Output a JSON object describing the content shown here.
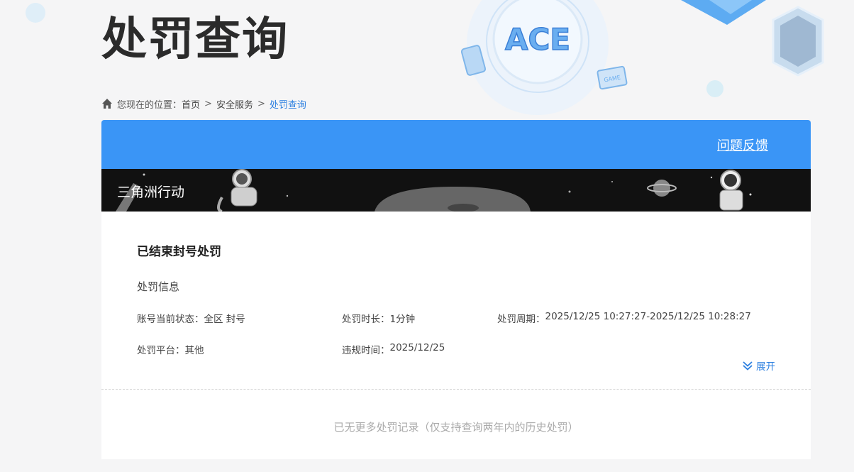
{
  "page": {
    "title": "处罚查询"
  },
  "breadcrumb": {
    "prefix": "您现在的位置：",
    "items": [
      "首页",
      "安全服务"
    ],
    "current": "处罚查询",
    "separator": ">"
  },
  "header": {
    "feedback_label": "问题反馈"
  },
  "banner": {
    "game_name": "三角洲行动",
    "logo_text": "ACE",
    "badge_text": "GAME"
  },
  "record": {
    "title": "已结束封号处罚",
    "section_label": "处罚信息",
    "fields": {
      "status_label": "账号当前状态：",
      "status_value": "全区 封号",
      "duration_label": "处罚时长：",
      "duration_value": "1分钟",
      "period_label": "处罚周期：",
      "period_value": "2025/12/25 10:27:27-2025/12/25 10:28:27",
      "platform_label": "处罚平台：",
      "platform_value": "其他",
      "violation_label": "违规时间：",
      "violation_value": "2025/12/25"
    },
    "expand_label": "展开"
  },
  "footer": {
    "no_more_text": "已无更多处罚记录（仅支持查询两年内的历史处罚）"
  },
  "colors": {
    "accent": "#3a95f6",
    "link": "#2b7fe0"
  }
}
